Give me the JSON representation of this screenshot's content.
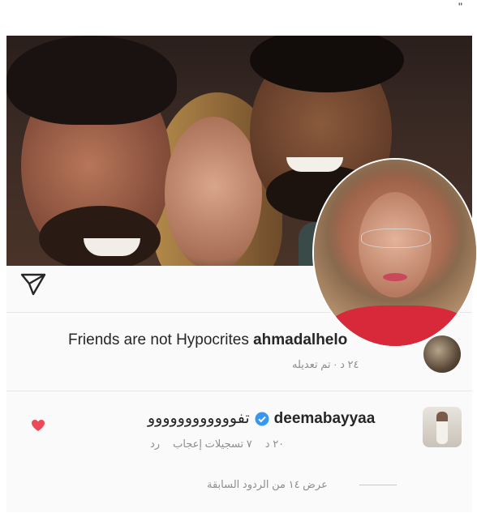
{
  "decor": {
    "quote_mark": "\""
  },
  "post": {
    "send_icon": "paper-plane-icon"
  },
  "comments": [
    {
      "text": "Friends are not Hypocrites",
      "username": "ahmadalhelo",
      "time": "٢٤ د",
      "edited": "تم تعديله",
      "separator": "·"
    },
    {
      "username": "deemabayyaa",
      "verified": true,
      "text": "تفوووووووووووو",
      "time": "٢٠ د",
      "likes": "٧ تسجيلات إعجاب",
      "reply": "رد",
      "liked": true
    }
  ],
  "view_replies": "عرض ١٤ من الردود السابقة",
  "colors": {
    "heart": "#ed4956",
    "verified": "#3897f0",
    "meta": "#8e8e8e"
  }
}
